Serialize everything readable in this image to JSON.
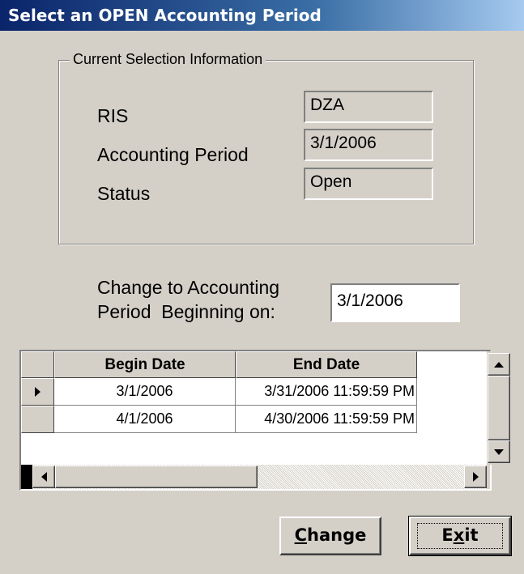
{
  "window": {
    "title": "Select an OPEN Accounting Period"
  },
  "current_selection": {
    "legend": "Current Selection Information",
    "ris_label": "RIS",
    "ris_value": "DZA",
    "period_label": "Accounting Period",
    "period_value": "3/1/2006",
    "status_label": "Status",
    "status_value": "Open"
  },
  "change": {
    "label_line1": "Change to Accounting",
    "label_line2": "Period  Beginning on:",
    "value": "3/1/2006"
  },
  "grid": {
    "columns": [
      "Begin Date",
      "End Date"
    ],
    "rows": [
      {
        "begin": "3/1/2006",
        "end": "3/31/2006 11:59:59 PM",
        "current": true
      },
      {
        "begin": "4/1/2006",
        "end": "4/30/2006 11:59:59 PM",
        "current": false
      }
    ]
  },
  "buttons": {
    "change_label": "Change",
    "exit_label": "Exit"
  }
}
